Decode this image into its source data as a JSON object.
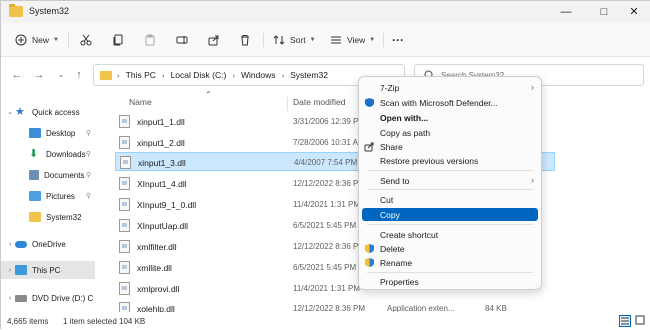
{
  "window": {
    "title": "System32"
  },
  "toolbar": {
    "new_label": "New",
    "sort_label": "Sort",
    "view_label": "View"
  },
  "address": {
    "crumbs": [
      "This PC",
      "Local Disk (C:)",
      "Windows",
      "System32"
    ],
    "search_placeholder": "Search System32"
  },
  "sidebar": {
    "items": [
      {
        "label": "Quick access"
      },
      {
        "label": "Desktop"
      },
      {
        "label": "Downloads"
      },
      {
        "label": "Documents"
      },
      {
        "label": "Pictures"
      },
      {
        "label": "System32"
      },
      {
        "label": "OneDrive"
      },
      {
        "label": "This PC"
      },
      {
        "label": "DVD Drive (D:) C"
      }
    ]
  },
  "columns": {
    "name": "Name",
    "date": "Date modified"
  },
  "files": [
    {
      "name": "xinput1_1.dll",
      "date": "3/31/2006 12:39 PM",
      "type": "",
      "size": ""
    },
    {
      "name": "xinput1_2.dll",
      "date": "7/28/2006 10:31 AM",
      "type": "",
      "size": ""
    },
    {
      "name": "xinput1_3.dll",
      "date": "4/4/2007 7:54 PM",
      "type": "",
      "size": ""
    },
    {
      "name": "XInput1_4.dll",
      "date": "12/12/2022 8:36 PM",
      "type": "",
      "size": ""
    },
    {
      "name": "XInput9_1_0.dll",
      "date": "11/4/2021 1:31 PM",
      "type": "",
      "size": ""
    },
    {
      "name": "XInputUap.dll",
      "date": "6/5/2021 5:45 PM",
      "type": "",
      "size": ""
    },
    {
      "name": "xmlfilter.dll",
      "date": "12/12/2022 8:36 PM",
      "type": "",
      "size": ""
    },
    {
      "name": "xmllite.dll",
      "date": "6/5/2021 5:45 PM",
      "type": "",
      "size": ""
    },
    {
      "name": "xmlprovi.dll",
      "date": "11/4/2021 1:31 PM",
      "type": "",
      "size": ""
    },
    {
      "name": "xolehlp.dll",
      "date": "12/12/2022 8:36 PM",
      "type": "Application exten...",
      "size": "84 KB"
    }
  ],
  "status": {
    "items_count": "4,665 items",
    "selected": "1 item selected",
    "size": "104 KB"
  },
  "context_menu": {
    "items": [
      {
        "label": "7-Zip"
      },
      {
        "label": "Scan with Microsoft Defender..."
      },
      {
        "label": "Open with..."
      },
      {
        "label": "Copy as path"
      },
      {
        "label": "Share"
      },
      {
        "label": "Restore previous versions"
      },
      {
        "label": "Send to"
      },
      {
        "label": "Cut"
      },
      {
        "label": "Copy"
      },
      {
        "label": "Create shortcut"
      },
      {
        "label": "Delete"
      },
      {
        "label": "Rename"
      },
      {
        "label": "Properties"
      }
    ]
  },
  "colors": {
    "accent": "#0067c0",
    "selection": "#cce8ff",
    "folder": "#f0c34a"
  }
}
